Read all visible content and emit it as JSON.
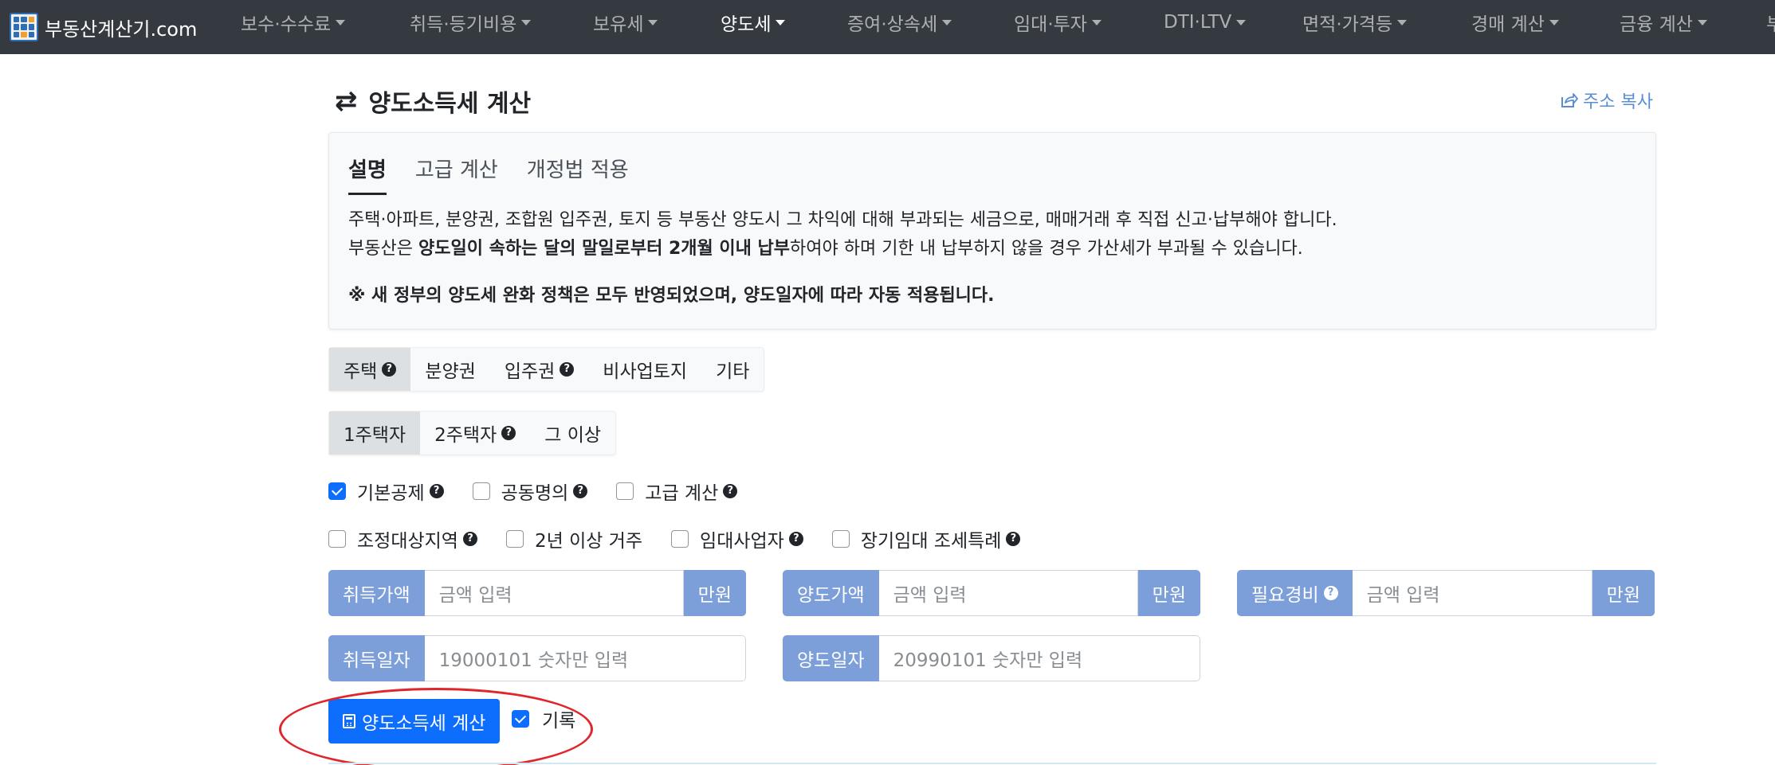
{
  "navbar": {
    "brand": "부동산계산기.com",
    "items": [
      {
        "label": "보수·수수료"
      },
      {
        "label": "취득·등기비용"
      },
      {
        "label": "보유세"
      },
      {
        "label": "양도세"
      },
      {
        "label": "증여·상속세"
      },
      {
        "label": "임대·투자"
      },
      {
        "label": "DTI·LTV"
      },
      {
        "label": "면적·가격등"
      },
      {
        "label": "경매 계산"
      },
      {
        "label": "금융 계산"
      },
      {
        "label": "부"
      }
    ]
  },
  "page": {
    "title": "양도소득세 계산",
    "share_label": "주소 복사"
  },
  "info": {
    "tabs": [
      "설명",
      "고급 계산",
      "개정법 적용"
    ],
    "desc_line1": "주택·아파트, 분양권, 조합원 입주권, 토지 등 부동산 양도시 그 차익에 대해 부과되는 세금으로, 매매거래 후 직접 신고·납부해야 합니다.",
    "desc_line2_pre": "부동산은 ",
    "desc_line2_bold": "양도일이 속하는 달의 말일로부터 2개월 이내 납부",
    "desc_line2_post": "하여야 하며 기한 내 납부하지 않을 경우 가산세가 부과될 수 있습니다.",
    "notice": "※ 새 정부의 양도세 완화 정책은 모두 반영되었으며, 양도일자에 따라 자동 적용됩니다."
  },
  "property_type": {
    "options": [
      "주택",
      "분양권",
      "입주권",
      "비사업토지",
      "기타"
    ],
    "selected": "주택"
  },
  "house_count": {
    "options": [
      "1주택자",
      "2주택자",
      "그 이상"
    ],
    "selected": "1주택자"
  },
  "checks_row1": [
    {
      "label": "기본공제",
      "checked": true
    },
    {
      "label": "공동명의",
      "checked": false
    },
    {
      "label": "고급 계산",
      "checked": false
    }
  ],
  "checks_row2": [
    {
      "label": "조정대상지역",
      "checked": false
    },
    {
      "label": "2년 이상 거주",
      "checked": false
    },
    {
      "label": "임대사업자",
      "checked": false
    },
    {
      "label": "장기임대 조세특례",
      "checked": false
    }
  ],
  "inputs": {
    "acquire_price": {
      "label": "취득가액",
      "placeholder": "금액 입력",
      "unit": "만원"
    },
    "transfer_price": {
      "label": "양도가액",
      "placeholder": "금액 입력",
      "unit": "만원"
    },
    "expense": {
      "label": "필요경비",
      "placeholder": "금액 입력",
      "unit": "만원"
    },
    "acquire_date": {
      "label": "취득일자",
      "placeholder": "19000101 숫자만 입력"
    },
    "transfer_date": {
      "label": "양도일자",
      "placeholder": "20990101 숫자만 입력"
    }
  },
  "actions": {
    "calc_label": "양도소득세 계산",
    "record_label": "기록",
    "record_checked": true
  },
  "colors": {
    "navbar": "#343a40",
    "addon": "#7c9fd9",
    "primary": "#0d6efd",
    "highlight_circle": "#e0262a"
  }
}
